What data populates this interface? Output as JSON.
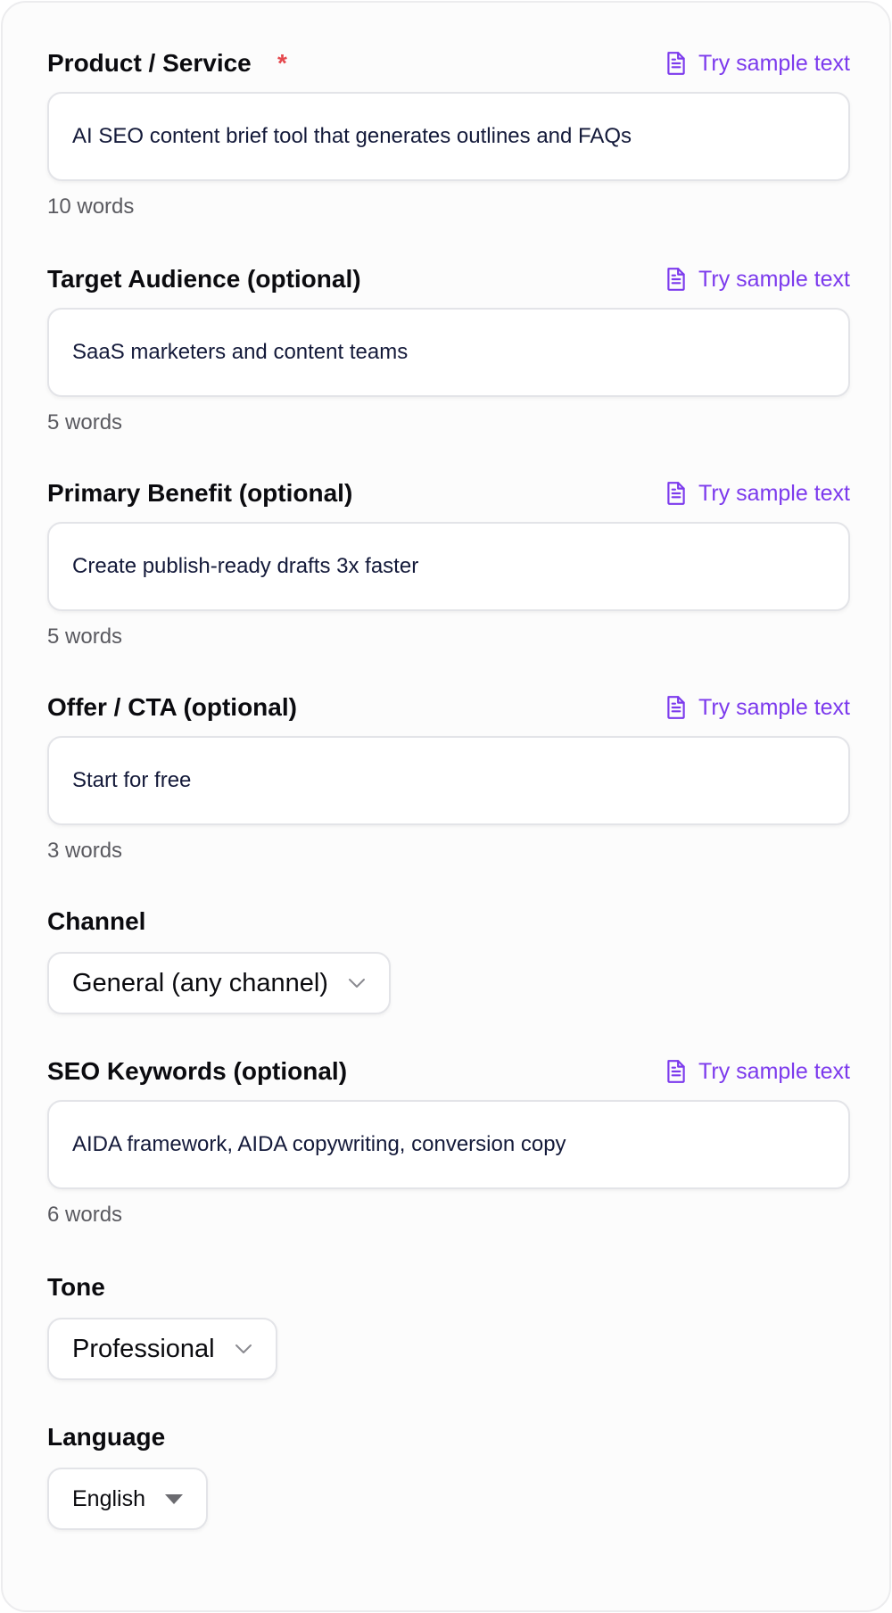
{
  "sample_link_label": "Try sample text",
  "fields": {
    "product": {
      "label": "Product / Service",
      "required_mark": "*",
      "value": "AI SEO content brief tool that generates outlines and FAQs",
      "count": "10 words"
    },
    "audience": {
      "label": "Target Audience (optional)",
      "value": "SaaS marketers and content teams",
      "count": "5 words"
    },
    "benefit": {
      "label": "Primary Benefit (optional)",
      "value": "Create publish-ready drafts 3x faster",
      "count": "5 words"
    },
    "offer": {
      "label": "Offer / CTA (optional)",
      "value": "Start for free",
      "count": "3 words"
    },
    "channel": {
      "label": "Channel",
      "selected": "General (any channel)"
    },
    "keywords": {
      "label": "SEO Keywords (optional)",
      "value": "AIDA framework, AIDA copywriting, conversion copy",
      "count": "6 words"
    },
    "tone": {
      "label": "Tone",
      "selected": "Professional"
    },
    "language": {
      "label": "Language",
      "selected": "English"
    }
  },
  "colors": {
    "accent": "#7c3aed",
    "required": "#e5484d",
    "border": "#e3e4e8",
    "value_text": "#141a3a"
  },
  "icons": {
    "sample": "document-icon",
    "dropdown": "chevron-down-icon",
    "dropdown_native": "caret-down-icon"
  }
}
